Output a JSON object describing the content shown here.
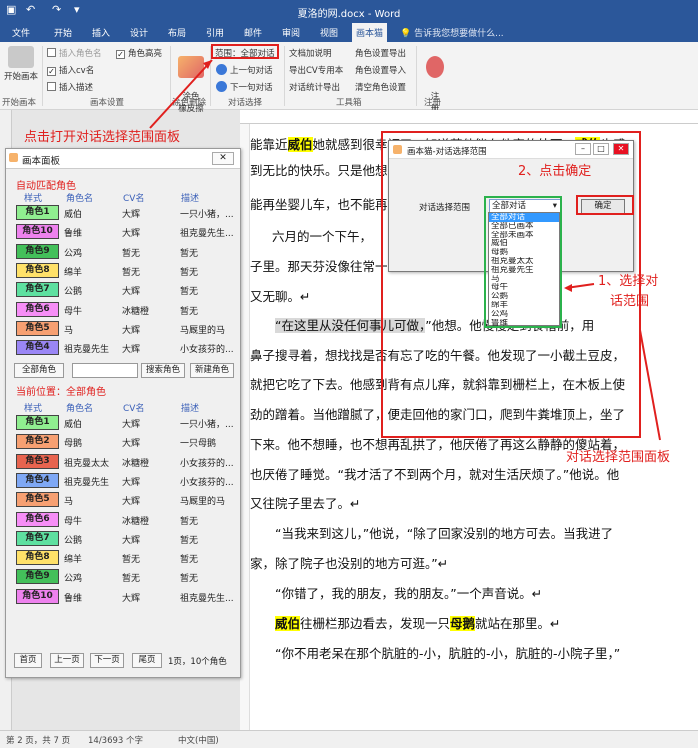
{
  "window": {
    "title": "夏洛的网.docx - Word"
  },
  "ribbon_tabs": [
    "文件",
    "开始",
    "插入",
    "设计",
    "布局",
    "引用",
    "邮件",
    "审阅",
    "视图",
    "画本猫"
  ],
  "active_tab": "画本猫",
  "tell_me": "告诉我您想要做什么...",
  "ribbon": {
    "start_script": "开始画本",
    "start_group": "开始画本",
    "chk_insert_name": "插入角色名",
    "chk_insert_cv": "插入cv名",
    "chk_insert_desc": "插入描述",
    "chk_highlight": "角色高亮",
    "settings_group": "画本设置",
    "eraser": "涂色\n橡皮擦",
    "eraser_group": "涂色删除",
    "range_btn": "范围：全部对话",
    "prev_dialog": "上一句对话",
    "next_dialog": "下一句对话",
    "dialog_group": "对话选择",
    "doc_dialog_use": "文档加说明",
    "export_cv": "导出CV专用本",
    "dialog_stats": "对话统计导出",
    "role_export": "角色设置导出",
    "role_import": "角色设置导入",
    "clear_roles": "清空角色设置",
    "tools_group": "工具箱",
    "register": "注\n册",
    "register_group": "注册"
  },
  "panel": {
    "title": "画本面板",
    "auto_match_title": "自动匹配角色",
    "current_pos_title": "当前位置：全部角色",
    "headers": [
      "样式",
      "角色名",
      "CV名",
      "描述"
    ],
    "auto_rows": [
      {
        "style": "角色1",
        "name": "威伯",
        "cv": "大辉",
        "desc": "一只小猪，...",
        "color": "#90ee90"
      },
      {
        "style": "角色10",
        "name": "鲁维",
        "cv": "大辉",
        "desc": "祖克曼先生...",
        "color": "#ee82ee"
      },
      {
        "style": "角色9",
        "name": "公鸡",
        "cv": "暂无",
        "desc": "暂无",
        "color": "#43c05a"
      },
      {
        "style": "角色8",
        "name": "绵羊",
        "cv": "暂无",
        "desc": "暂无",
        "color": "#ffe169"
      },
      {
        "style": "角色7",
        "name": "公鹅",
        "cv": "大辉",
        "desc": "暂无",
        "color": "#5ee0a0"
      },
      {
        "style": "角色6",
        "name": "母牛",
        "cv": "冰糖橙",
        "desc": "暂无",
        "color": "#f78ef7"
      },
      {
        "style": "角色5",
        "name": "马",
        "cv": "大辉",
        "desc": "马厩里的马",
        "color": "#f7a072"
      },
      {
        "style": "角色4",
        "name": "祖克曼先生",
        "cv": "大辉",
        "desc": "小女孩芬的...",
        "color": "#9a86f5"
      }
    ],
    "all_roles_btn": "全部角色",
    "search_btn": "搜索角色",
    "new_btn": "新建角色",
    "current_rows": [
      {
        "style": "角色1",
        "name": "威伯",
        "cv": "大辉",
        "desc": "一只小猪，...",
        "color": "#90ee90"
      },
      {
        "style": "角色2",
        "name": "母鹅",
        "cv": "大辉",
        "desc": "一只母鹅",
        "color": "#f7a072"
      },
      {
        "style": "角色3",
        "name": "祖克曼太太",
        "cv": "冰糖橙",
        "desc": "小女孩芬的...",
        "color": "#e8644f"
      },
      {
        "style": "角色4",
        "name": "祖克曼先生",
        "cv": "大辉",
        "desc": "小女孩芬的...",
        "color": "#7fa8f5"
      },
      {
        "style": "角色5",
        "name": "马",
        "cv": "大辉",
        "desc": "马厩里的马",
        "color": "#f7a072"
      },
      {
        "style": "角色6",
        "name": "母牛",
        "cv": "冰糖橙",
        "desc": "暂无",
        "color": "#f78ef7"
      },
      {
        "style": "角色7",
        "name": "公鹅",
        "cv": "大辉",
        "desc": "暂无",
        "color": "#5ee0a0"
      },
      {
        "style": "角色8",
        "name": "绵羊",
        "cv": "暂无",
        "desc": "暂无",
        "color": "#ffe169"
      },
      {
        "style": "角色9",
        "name": "公鸡",
        "cv": "暂无",
        "desc": "暂无",
        "color": "#43c05a"
      },
      {
        "style": "角色10",
        "name": "鲁维",
        "cv": "大辉",
        "desc": "祖克曼先生...",
        "color": "#ee82ee"
      }
    ],
    "first_page": "首页",
    "prev_page": "上一页",
    "next_page": "下一页",
    "last_page": "尾页",
    "page_info": "1页，10个角色"
  },
  "dialog": {
    "title": "画本猫-对话选择范围",
    "label": "对话选择范围",
    "selected": "全部对话",
    "confirm": "确定",
    "options": [
      "全部对话",
      "全部已画本",
      "全部未画本",
      "威伯",
      "母鹅",
      "祖克曼太太",
      "祖克曼先生",
      "马",
      "母牛",
      "公鹅",
      "绵羊",
      "公鸡",
      "鲁维"
    ]
  },
  "annotations": {
    "a1": "点击打开对话选择范围面板",
    "a2": "2、点击确定",
    "a3_line1": "1、选择对",
    "a3_line2": "话范围",
    "a4": "对话选择范围面板"
  },
  "document": {
    "line1_pre": "能靠近",
    "line1_hl": "威伯",
    "line1_post": "她就感到很幸福了。知道若他能在他家的外面，",
    "line1_hl2": "威伯",
    "line1_end": "也感",
    "line2": "到无比的快乐。只是他想",
    "line3": "能再坐婴儿车，也不能再",
    "line4": "六月的一个下午，",
    "line5": "子里。那天芬没像往常一",
    "line6": "又无聊。↵",
    "line7_hl": "“在这里从没任何事儿可做，",
    "line7_post": "”他想。他慢慢走到食槽前，用",
    "line8": "鼻子搜寻着，想找找是否有忘了吃的午餐。他发现了一小截土豆皮，",
    "line9": "就把它吃了下去。他感到背有点儿痒，就斜靠到栅栏上，在木板上使",
    "line10": "劲的蹭着。当他蹭腻了，便走回他的家门口，爬到牛粪堆顶上，坐了",
    "line11": "下来。他不想睡，也不想再乱拱了，他厌倦了再这么静静的傻站着，",
    "line12": "也厌倦了睡觉。“我才活了不到两个月，就对生活厌烦了。”他说。他",
    "line13": "又往院子里去了。↵",
    "line14": "“当我来到这儿，”他说，“除了回家没别的地方可去。当我进了",
    "line15": "家，除了院子也没别的地方可逛。”↵",
    "line16": "“你错了，我的朋友，我的朋友。”一个声音说。↵",
    "line17_hl": "威伯",
    "line17_mid": "往栅栏那边看去，发现一只",
    "line17_hl2": "母鹅",
    "line17_end": "就站在那里。↵",
    "line18": "“你不用老呆在那个肮脏的-小，肮脏的-小，肮脏的-小院子里，”"
  },
  "status": {
    "page": "第 2 页，共 7 页",
    "words": "14/3693 个字",
    "lang": "中文(中国)"
  }
}
